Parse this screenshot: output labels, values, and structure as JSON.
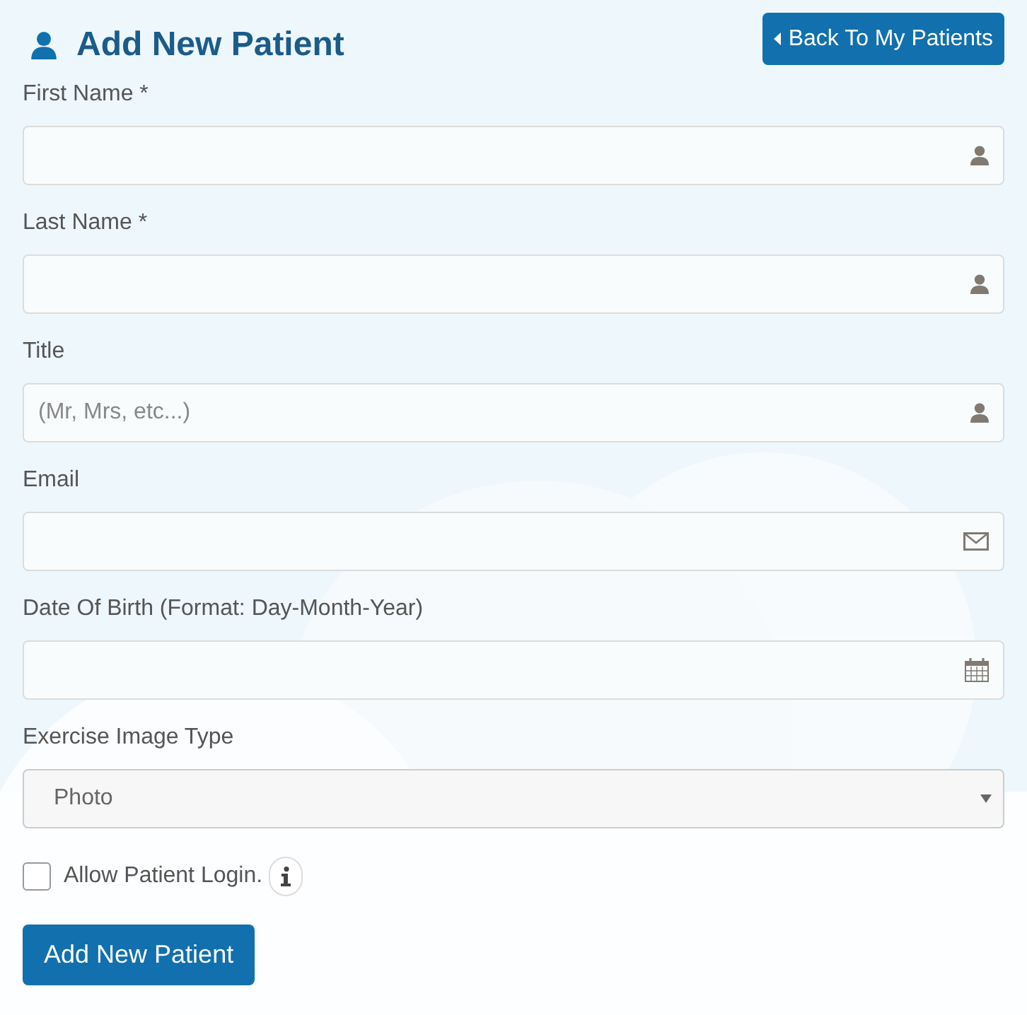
{
  "header": {
    "title": "Add New Patient",
    "back_button": "Back To My Patients"
  },
  "fields": [
    {
      "label": "First Name *",
      "kind": "person"
    },
    {
      "label": "Last Name *",
      "kind": "person"
    },
    {
      "label": "Title",
      "kind": "person",
      "placeholder": "(Mr, Mrs, etc...)"
    },
    {
      "label": "Email",
      "kind": "mail"
    },
    {
      "label": "Date Of Birth (Format: Day-Month-Year)",
      "kind": "calendar"
    }
  ],
  "image_type": {
    "label": "Exercise Image Type",
    "value": "Photo"
  },
  "allow_login": {
    "label": "Allow Patient Login.",
    "checked": false
  },
  "submit_button": "Add New Patient"
}
